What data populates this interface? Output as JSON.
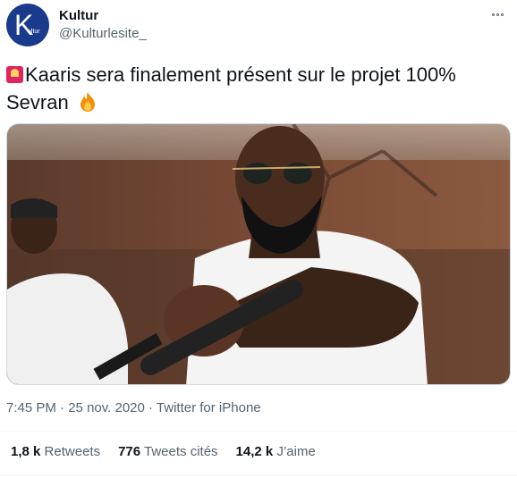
{
  "author": {
    "name": "Kultur",
    "handle": "@Kulturlesite_",
    "avatar_letter": "K",
    "avatar_subtext": "ultur",
    "avatar_color": "#1a3a8c"
  },
  "tweet": {
    "text_line1": "Kaaris sera finalement présent sur le projet 100%",
    "text_line2": "Sevran",
    "emojis": [
      "siren-icon",
      "fire-icon"
    ]
  },
  "meta": {
    "time": "7:45 PM",
    "separator1": " · ",
    "date": "25 nov. 2020",
    "separator2": " · ",
    "source": "Twitter for iPhone"
  },
  "stats": {
    "retweets_count": "1,8 k",
    "retweets_label": "Retweets",
    "quotes_count": "776",
    "quotes_label": "Tweets cités",
    "likes_count": "14,2 k",
    "likes_label": "J’aime"
  },
  "colors": {
    "text_primary": "#0f1419",
    "text_secondary": "#536471",
    "divider": "#eff3f4"
  }
}
